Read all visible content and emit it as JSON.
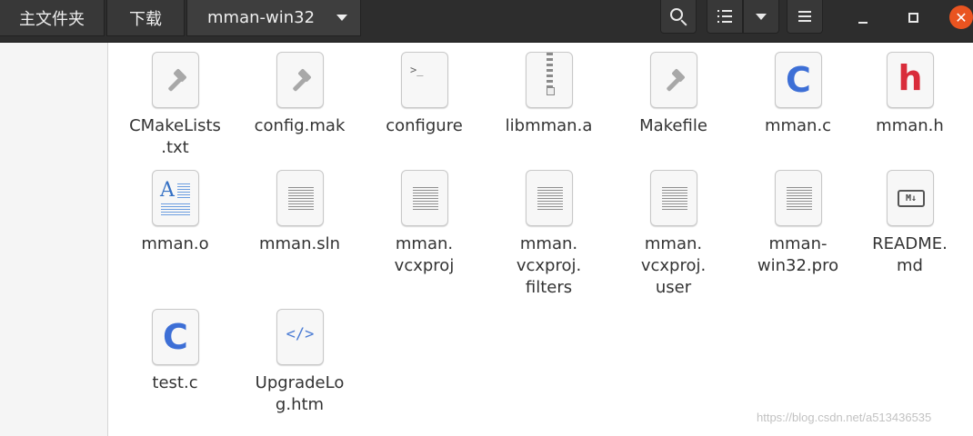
{
  "header": {
    "breadcrumbs": [
      "主文件夹",
      "下载",
      "mman-win32"
    ],
    "close_glyph": "✕"
  },
  "icons": {
    "search": "search-icon",
    "view": "list-view-icon",
    "view_dropdown": "chevron-down-icon",
    "menu": "hamburger-menu-icon",
    "minimize": "minimize-icon",
    "maximize": "maximize-icon",
    "close": "close-icon"
  },
  "files": [
    {
      "name": "CMakeLists\n.txt",
      "icon": "hammer-icon"
    },
    {
      "name": "config.mak",
      "icon": "hammer-icon"
    },
    {
      "name": "configure",
      "icon": "terminal-icon",
      "glyph": ">_"
    },
    {
      "name": "libmman.a",
      "icon": "archive-icon"
    },
    {
      "name": "Makefile",
      "icon": "hammer-icon"
    },
    {
      "name": "mman.c",
      "icon": "c-source-icon",
      "glyph": "C"
    },
    {
      "name": "mman.h",
      "icon": "c-header-icon",
      "glyph": "h"
    },
    {
      "name": "mman.o",
      "icon": "text-document-icon",
      "glyph": "A"
    },
    {
      "name": "mman.sln",
      "icon": "plain-text-icon"
    },
    {
      "name": "mman.\nvcxproj",
      "icon": "plain-text-icon"
    },
    {
      "name": "mman.\nvcxproj.\nfilters",
      "icon": "plain-text-icon"
    },
    {
      "name": "mman.\nvcxproj.\nuser",
      "icon": "plain-text-icon"
    },
    {
      "name": "mman-\nwin32.pro",
      "icon": "plain-text-icon"
    },
    {
      "name": "README.\nmd",
      "icon": "markdown-icon",
      "glyph": "M↓"
    },
    {
      "name": "test.c",
      "icon": "c-source-icon",
      "glyph": "C"
    },
    {
      "name": "UpgradeLo\ng.htm",
      "icon": "html-icon",
      "glyph": "</>"
    }
  ],
  "watermark": "https://blog.csdn.net/a513436535",
  "colors": {
    "header_bg": "#2d2d2d",
    "close_button": "#e95420",
    "c_icon": "#3d6fd6",
    "h_icon": "#d92d3b"
  }
}
